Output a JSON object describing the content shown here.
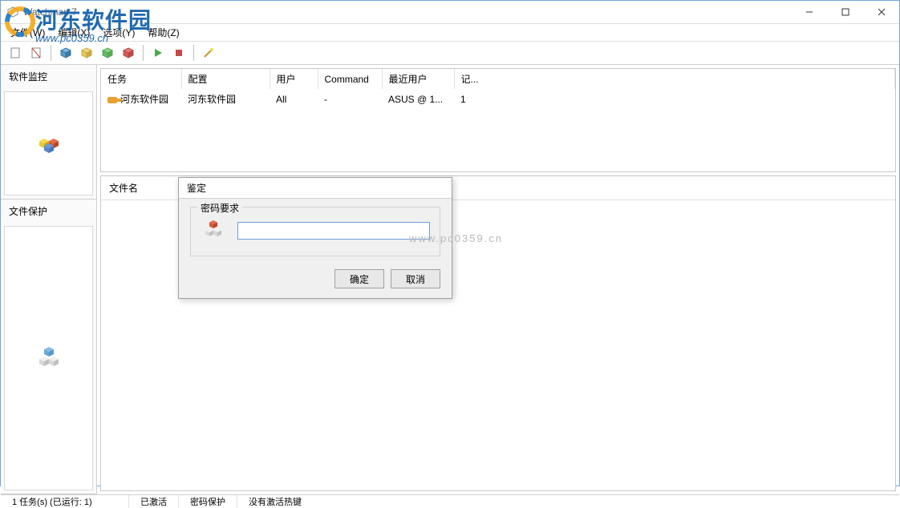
{
  "window": {
    "title": "Watchman 7"
  },
  "menu": {
    "file": "文件(W)",
    "edit": "编辑(X)",
    "options": "选项(Y)",
    "help": "帮助(Z)"
  },
  "sidebar": {
    "section1": {
      "title": "软件监控"
    },
    "section2": {
      "title": "文件保护"
    }
  },
  "table": {
    "headers": {
      "task": "任务",
      "config": "配置",
      "user": "用户",
      "command": "Command",
      "lastuser": "最近用户",
      "record": "记..."
    },
    "row1": {
      "task": "河东软件园",
      "config": "河东软件园",
      "user": "All",
      "command": "-",
      "lastuser": "ASUS @ 1...",
      "record": "1"
    }
  },
  "bottom": {
    "header": "文件名"
  },
  "dialog": {
    "title": "鉴定",
    "group": "密码要求",
    "ok": "确定",
    "cancel": "取消",
    "value": ""
  },
  "status": {
    "tasks": "1 任务(s) (已运行: 1)",
    "active": "已激活",
    "pwprotect": "密码保护",
    "hotkey": "没有激活热键"
  },
  "watermark": {
    "name": "河东软件园",
    "url": "www.pc0359.cn",
    "center": "www.pc0359.cn"
  }
}
